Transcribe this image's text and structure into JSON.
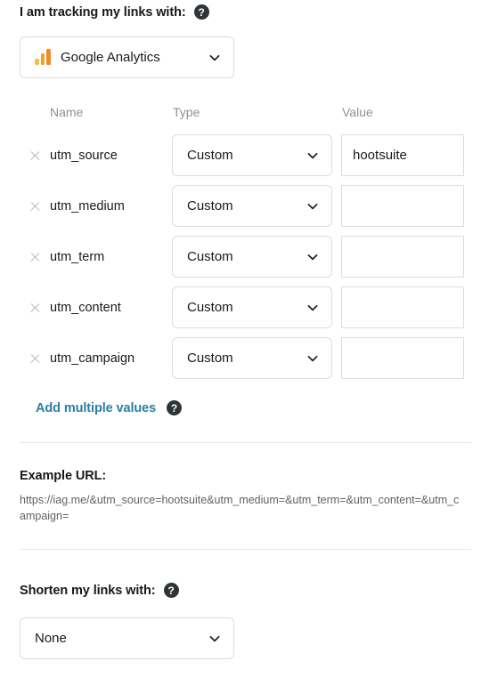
{
  "tracking": {
    "label": "I am tracking my links with:",
    "help_icon": "help-circle-icon",
    "provider": {
      "value": "Google Analytics",
      "icon": "google-analytics-icon",
      "chevron": "chevron-down-icon"
    }
  },
  "table": {
    "headers": {
      "name": "Name",
      "type": "Type",
      "value": "Value"
    },
    "remove_icon": "close-x-icon",
    "chevron_icon": "chevron-down-icon",
    "value_placeholder": "",
    "rows": [
      {
        "name": "utm_source",
        "type": "Custom",
        "value": "hootsuite"
      },
      {
        "name": "utm_medium",
        "type": "Custom",
        "value": ""
      },
      {
        "name": "utm_term",
        "type": "Custom",
        "value": ""
      },
      {
        "name": "utm_content",
        "type": "Custom",
        "value": ""
      },
      {
        "name": "utm_campaign",
        "type": "Custom",
        "value": ""
      }
    ]
  },
  "add_multiple": {
    "label": "Add multiple values",
    "help_icon": "help-circle-icon"
  },
  "example_url": {
    "title": "Example URL:",
    "value": "https://iag.me/&utm_source=hootsuite&utm_medium=&utm_term=&utm_content=&utm_campaign="
  },
  "shorten": {
    "label": "Shorten my links with:",
    "help_icon": "help-circle-icon",
    "selected": "None",
    "chevron": "chevron-down-icon"
  },
  "colors": {
    "link": "#2b7fa3",
    "border": "#dcdcdc",
    "muted_text": "#8d9196",
    "ga_orange": "#ef8b26"
  }
}
